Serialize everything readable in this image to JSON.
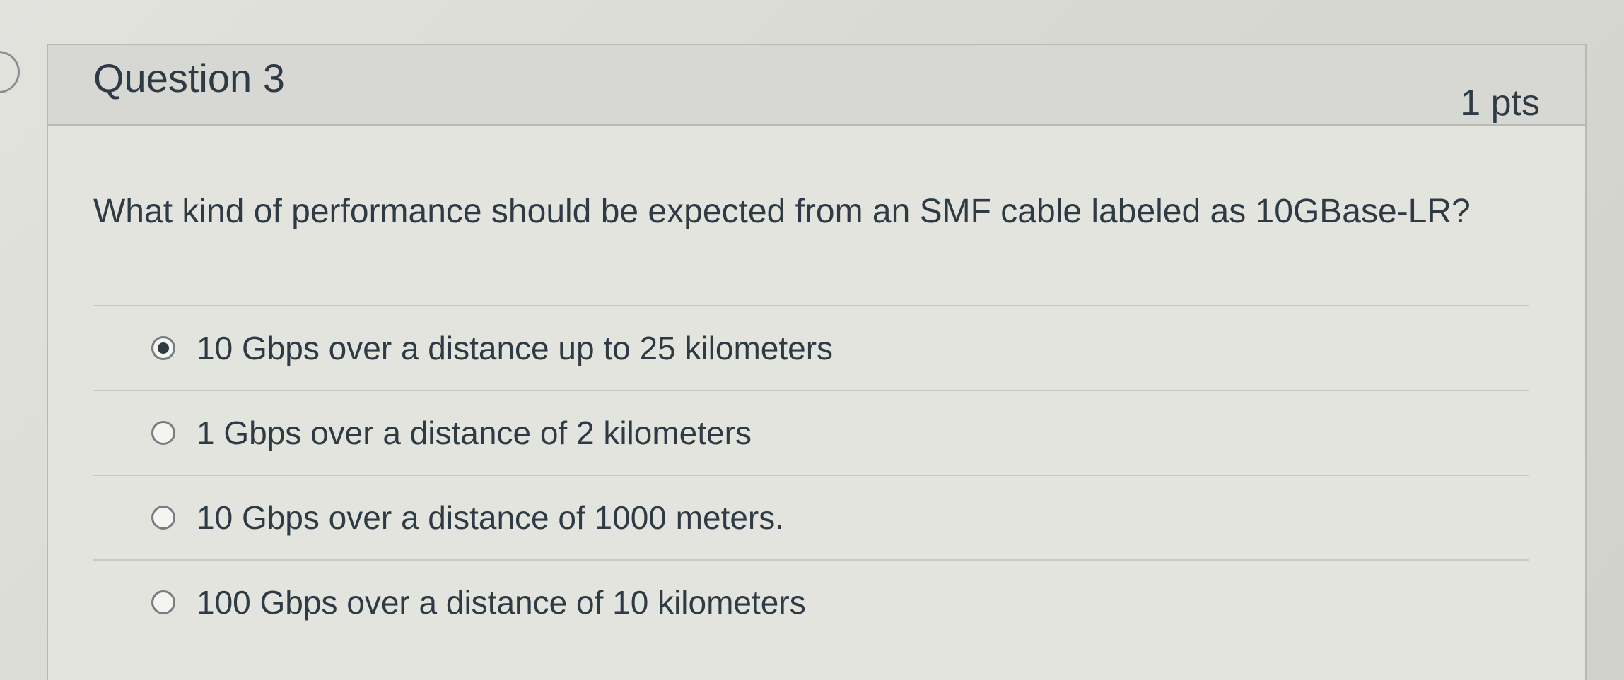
{
  "question": {
    "title": "Question 3",
    "points": "1 pts",
    "text": "What kind of performance should be expected from an SMF cable labeled as 10GBase-LR?"
  },
  "answers": [
    {
      "label": "10 Gbps over a distance up to 25 kilometers",
      "selected": true
    },
    {
      "label": "1 Gbps over a distance of 2 kilometers",
      "selected": false
    },
    {
      "label": "10 Gbps over a distance of 1000 meters.",
      "selected": false
    },
    {
      "label": "100 Gbps over a distance of 10 kilometers",
      "selected": false
    }
  ]
}
